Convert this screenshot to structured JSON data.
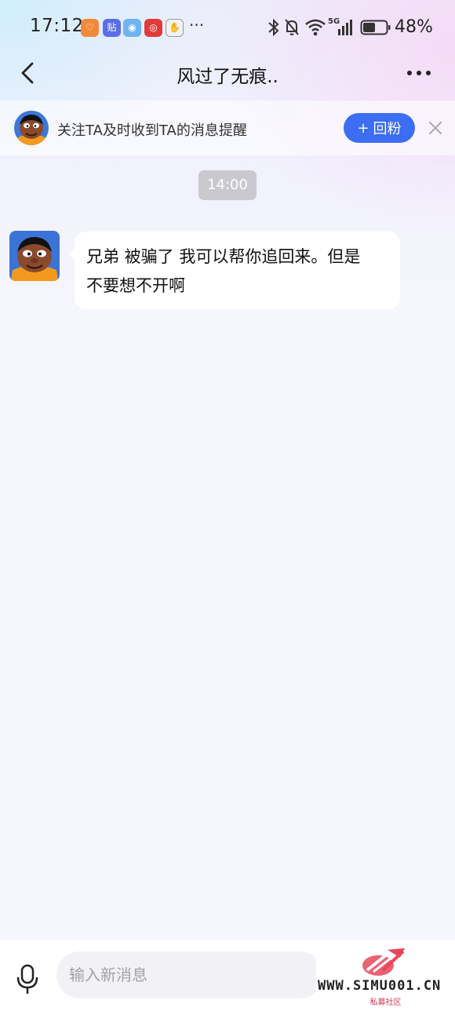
{
  "status_bar": {
    "time": "17:12",
    "app_icons": [
      {
        "name": "heart-app-icon",
        "glyph": "♡",
        "color": "#f08a3a"
      },
      {
        "name": "tieba-app-icon",
        "glyph": "贴",
        "color": "#5b6ee8"
      },
      {
        "name": "game-app-icon",
        "glyph": "◉",
        "color": "#6fb4f2"
      },
      {
        "name": "netease-music-app-icon",
        "glyph": "◎",
        "color": "#e23a3a"
      },
      {
        "name": "hand-app-icon",
        "glyph": "✋",
        "color": "#f2f2f2"
      }
    ],
    "more_dots": "···",
    "network": "5G",
    "battery": "48%"
  },
  "nav": {
    "title": "风过了无痕.."
  },
  "follow_banner": {
    "text": "关注TA及时收到TA的消息提醒",
    "button_label": "回粉",
    "button_plus": "+",
    "accent": "#3d6df2"
  },
  "chat": {
    "timestamp": "14:00",
    "message_line1": "兄弟 被骗了 我可以帮你追回来。但是",
    "message_line2": "不要想不开啊"
  },
  "input": {
    "placeholder": "输入新消息"
  },
  "watermark": {
    "text": "WWW.SIMU001.CN",
    "sub": "私募社区"
  }
}
